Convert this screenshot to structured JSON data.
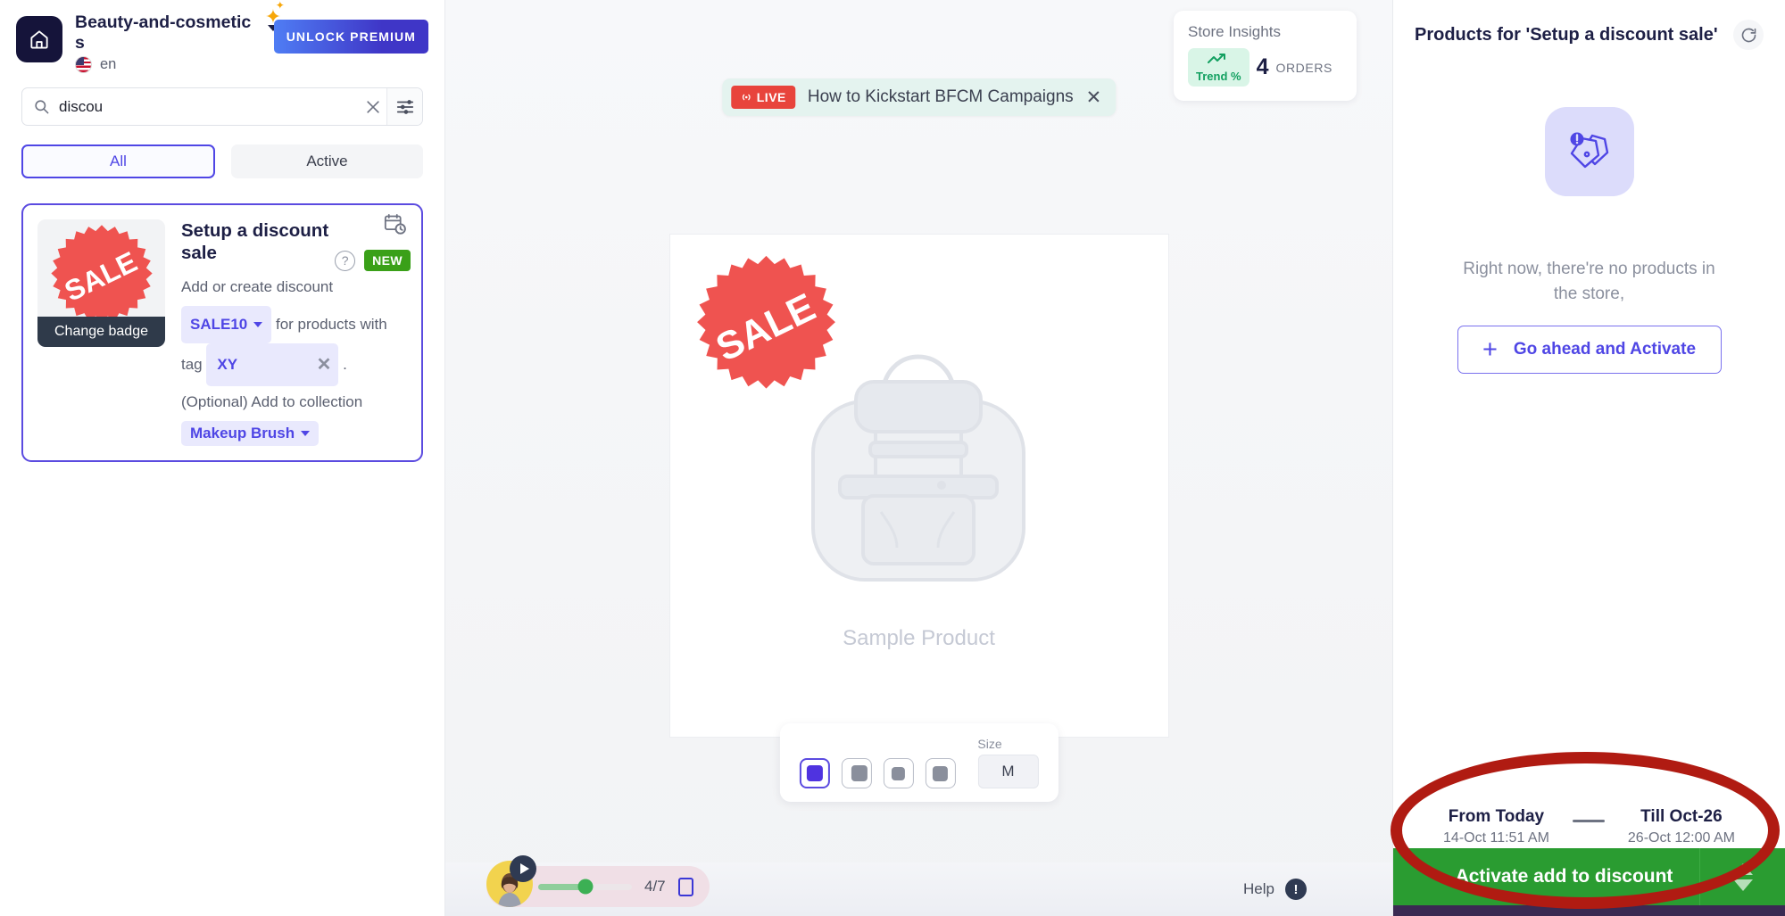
{
  "sidebar": {
    "home_icon": "home-icon",
    "store_name": "Beauty-and-cosmetics",
    "language": "en",
    "premium_label": "UNLOCK PREMIUM",
    "search": {
      "value": "discou",
      "placeholder": "Search"
    },
    "tabs": [
      {
        "label": "All",
        "active": true
      },
      {
        "label": "Active",
        "active": false
      }
    ],
    "card": {
      "badge_image_text": "SALE",
      "change_badge_label": "Change badge",
      "title": "Setup a discount sale",
      "new_badge": "NEW",
      "help_icon": "question-mark-icon",
      "schedule_icon": "calendar-clock-icon",
      "subtitle": "Add or create discount",
      "discount_chip": "SALE10",
      "text_for_products": "for products with",
      "text_tag": "tag",
      "tag_value": "XY",
      "period": ".",
      "optional_line": "(Optional) Add to collection",
      "collection_chip": "Makeup Brush"
    }
  },
  "center": {
    "live_banner": {
      "pill": "LIVE",
      "title": "How to Kickstart BFCM Campaigns",
      "close_icon": "close-icon"
    },
    "insights": {
      "title": "Store Insights",
      "trend_label": "Trend %",
      "orders_count": "4",
      "orders_label": "ORDERS"
    },
    "preview": {
      "badge_text": "SALE",
      "product_name": "Sample Product"
    },
    "variants": {
      "swatches": [
        "swatch-1-selected",
        "swatch-2",
        "swatch-3",
        "swatch-4"
      ],
      "size_label": "Size",
      "size_value": "M"
    },
    "guide": {
      "step_count": "4/7",
      "progress_percent": 52,
      "play_icon": "play-icon",
      "step_box_icon": "square-outline-icon"
    },
    "help": {
      "label": "Help",
      "icon": "info-icon"
    }
  },
  "right_panel": {
    "title": "Products for 'Setup a discount sale'",
    "refresh_icon": "refresh-icon",
    "empty_icon": "tags-alert-icon",
    "empty_text": "Right now, there're no products in the store,",
    "activate_button": "Go ahead and Activate",
    "date_from": {
      "main": "From Today",
      "sub": "14-Oct 11:51 AM"
    },
    "date_till": {
      "main": "Till Oct-26",
      "sub": "26-Oct 12:00 AM"
    },
    "activate_bar_label": "Activate add to discount",
    "stepper_icons": [
      "up-arrow-icon",
      "down-arrow-icon"
    ]
  },
  "annotation": {
    "shape": "red-ellipse-highlight",
    "color": "#b01b12"
  }
}
